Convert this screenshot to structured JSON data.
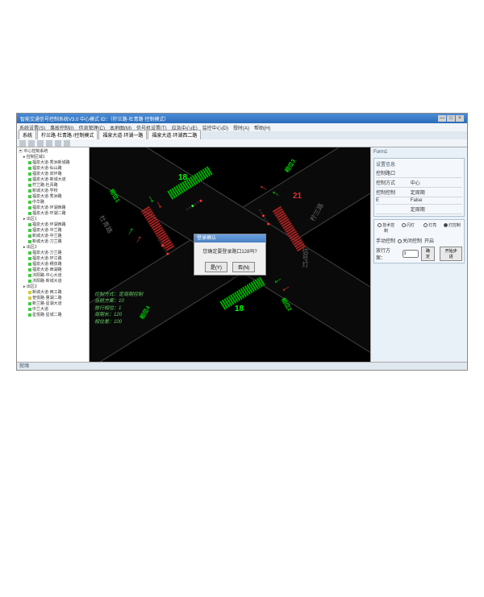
{
  "window": {
    "title": "智能交通信号控制系统V3.0 中心模式   ID：（柠兰路·杜青路  控制模式）",
    "win_min": "—",
    "win_max": "□",
    "win_close": "×"
  },
  "menubar": [
    "系统设置(S)",
    "事故控制(I)",
    "信息管理(C)",
    "本地图(M)",
    "信号机设置(T)",
    "应急中心(E)",
    "监控中心(D)",
    "授时(A)",
    "帮助(H)"
  ],
  "tabs": [
    {
      "label": "系统",
      "active": false
    },
    {
      "label": "柠兰路·杜青路 /控制模式",
      "active": true
    },
    {
      "label": "福泉大道·环湖一路",
      "active": false
    },
    {
      "label": "福泉大道·环湖西二路",
      "active": false
    }
  ],
  "tree": {
    "root": "中心控制系统",
    "group1": "控制区域1",
    "items": [
      "福泉大道·秀洲新城路",
      "福泉大道·仙山路",
      "福泉大道·双环路",
      "福泉大道·新城大道",
      "柠兰路·杜青路",
      "新城大道·学校",
      "福泉大道·秀洲路",
      "中华路",
      "福泉大道·环湖西路",
      "福泉大道·环湖二路"
    ],
    "group2": "出区1",
    "items2": [
      "福泉大道·环湖西路",
      "福泉大道·中兰路",
      "新城大道·中兰路",
      "新城大道·刀兰路"
    ],
    "group3": "出区2",
    "items3": [
      "福泉大道·刀兰路",
      "福泉大道·环江路",
      "福泉大道·穗泉路",
      "福泉大道·西湖路",
      "沐阳路·中心大道",
      "沐阳路·新城大道"
    ],
    "group4": "出区3",
    "items4": [
      "新城大道·西工路",
      "普悦路·量湖二路",
      "新兰路·星湖大道",
      "中兰大道",
      "星悦路·星城二路"
    ]
  },
  "intersection": {
    "road_nw": "杜青路",
    "road_se": "柠兰路",
    "signal_box": "信号灯",
    "phase1": "相位1",
    "phase2": "相位2",
    "phase3": "相位3",
    "phase4": "相位4",
    "counter_top": "18",
    "counter_right": "21",
    "counter_bottom": "18"
  },
  "info": {
    "line1_k": "控制方式：",
    "line1_v": "定周期控制",
    "line2_k": "当前方案：",
    "line2_v": "10",
    "line3_k": "放行相位：",
    "line3_v": "1",
    "line4_k": "周期长：",
    "line4_v": "120",
    "line5_k": "相位差：",
    "line5_v": "100"
  },
  "dialog": {
    "title": "登录确认",
    "message": "您确定要登录路口128吗?",
    "ok": "是(Y)",
    "cancel": "否(N)"
  },
  "rightpanel": {
    "title": "Form1",
    "group1": "设置信息",
    "rows": [
      {
        "k": "控制路口",
        "v": ""
      },
      {
        "k": "控制方式",
        "v": "中心"
      },
      {
        "k": "控制控制",
        "v": "定周期"
      },
      {
        "k": "E",
        "v": "False"
      },
      {
        "k": "",
        "v": "定周期"
      }
    ],
    "ctrl_header": [
      "技术控制",
      "闪灯",
      "灯亮",
      "灯控制"
    ],
    "manual_label": "手动控制",
    "manual_opts": [
      "关闭控制",
      "开启"
    ],
    "plan_label": "放行方案：",
    "plan_value": "0",
    "btn_apply": "确定",
    "btn_step": "开始步进"
  },
  "statusbar": "就绪"
}
